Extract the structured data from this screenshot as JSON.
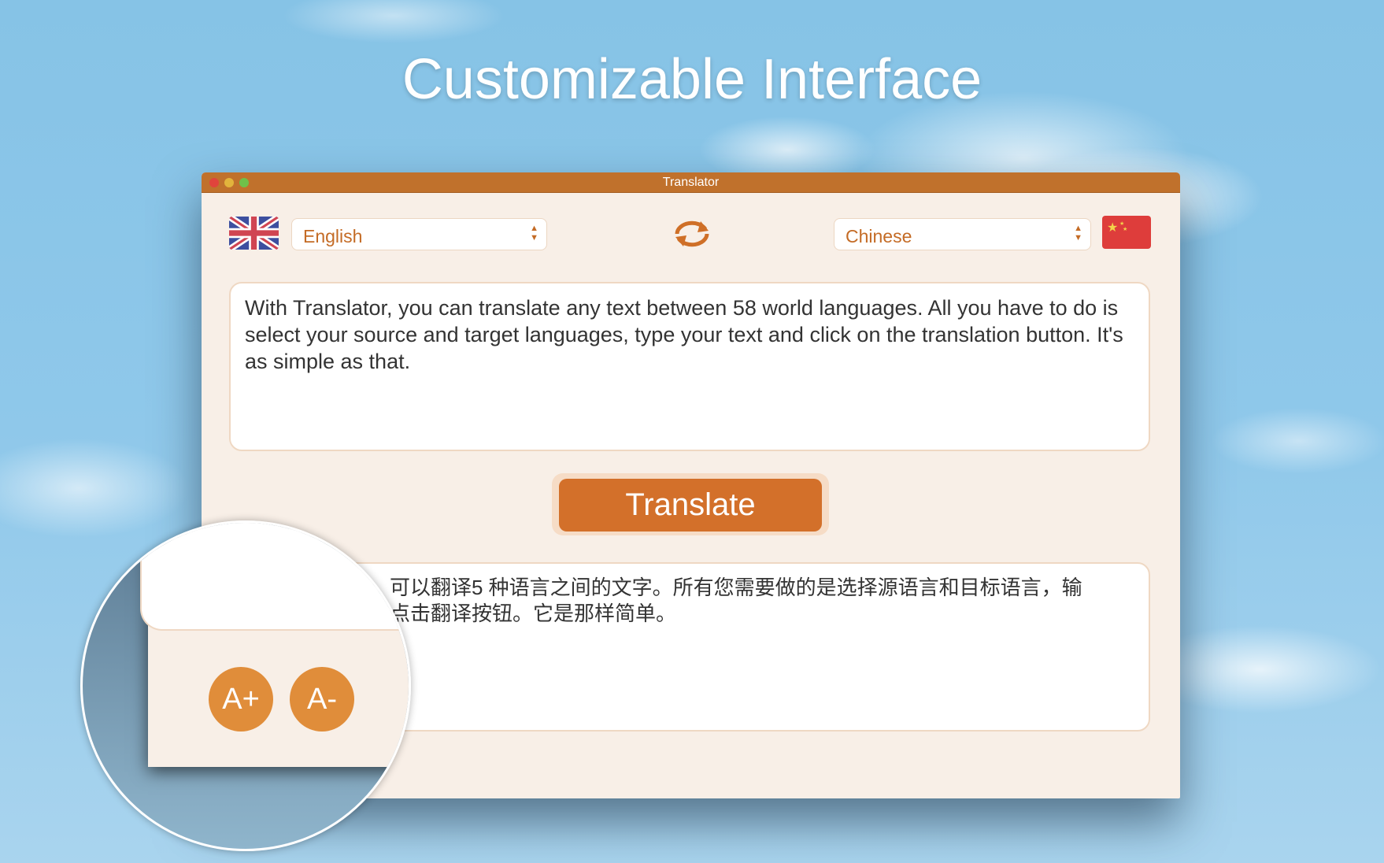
{
  "headline": "Customizable Interface",
  "window": {
    "title": "Translator"
  },
  "source": {
    "language": "English",
    "flag": "uk-flag-icon"
  },
  "target": {
    "language": "Chinese",
    "flag": "china-flag-icon"
  },
  "input_text": "With Translator, you can translate any text between 58 world languages.  All you have to do is select your source and target languages, type your text and click on the translation button. It's as simple as that.",
  "translate_label": "Translate",
  "output_lines": [
    "可以翻译5 种语言之间的文字。所有您需要做的是选择源语言和目标语言，输",
    "点击翻译按钮。它是那样简单。"
  ],
  "font_buttons": {
    "increase": "A+",
    "decrease": "A-"
  },
  "colors": {
    "accent": "#d3702a",
    "titlebar": "#c0712c",
    "window_bg": "#f8efe7"
  }
}
